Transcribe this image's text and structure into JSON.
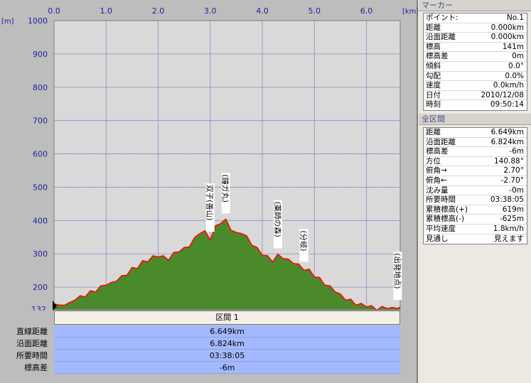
{
  "chart": {
    "unit_left": "[m]",
    "unit_right": "[km]",
    "x_ticks": [
      "0.0",
      "1.0",
      "2.0",
      "3.0",
      "4.0",
      "5.0",
      "6.0"
    ],
    "y_ticks": [
      "1000",
      "900",
      "800",
      "700",
      "600",
      "500",
      "400",
      "300",
      "200"
    ],
    "y_min_label": "132",
    "annotations": [
      {
        "text": "双子(善山)",
        "km": 3.0
      },
      {
        "text": "(鐘ガ丸)",
        "km": 3.3
      },
      {
        "text": "(薬師の森)",
        "km": 4.3
      },
      {
        "text": "(分岐)",
        "km": 4.8
      },
      {
        "text": "(出発地点)",
        "km": 6.6
      }
    ],
    "colors": {
      "fill": "#4a8a2a",
      "line": "#ff0000",
      "plot_bg": "#d9d9d9",
      "grid": "#4040c0"
    }
  },
  "chart_data": {
    "type": "area",
    "xlabel": "[km]",
    "ylabel": "[m]",
    "xlim": [
      0,
      6.649
    ],
    "ylim": [
      132,
      1000
    ],
    "grid": true,
    "x": [
      0.0,
      0.1,
      0.2,
      0.3,
      0.4,
      0.5,
      0.6,
      0.7,
      0.8,
      0.9,
      1.0,
      1.1,
      1.2,
      1.3,
      1.4,
      1.5,
      1.6,
      1.7,
      1.8,
      1.9,
      2.0,
      2.1,
      2.2,
      2.3,
      2.4,
      2.5,
      2.6,
      2.7,
      2.8,
      2.9,
      3.0,
      3.1,
      3.2,
      3.3,
      3.4,
      3.5,
      3.6,
      3.7,
      3.8,
      3.9,
      4.0,
      4.1,
      4.2,
      4.3,
      4.4,
      4.5,
      4.6,
      4.7,
      4.8,
      4.9,
      5.0,
      5.1,
      5.2,
      5.3,
      5.4,
      5.5,
      5.6,
      5.7,
      5.8,
      5.9,
      6.0,
      6.1,
      6.2,
      6.3,
      6.4,
      6.5,
      6.6,
      6.649
    ],
    "y": [
      150,
      142,
      150,
      150,
      165,
      170,
      175,
      185,
      190,
      200,
      210,
      210,
      222,
      230,
      240,
      255,
      260,
      275,
      280,
      290,
      295,
      290,
      285,
      300,
      310,
      315,
      325,
      345,
      365,
      365,
      345,
      380,
      395,
      400,
      375,
      360,
      365,
      350,
      330,
      315,
      300,
      290,
      280,
      295,
      290,
      280,
      275,
      265,
      255,
      250,
      235,
      225,
      210,
      200,
      190,
      175,
      165,
      160,
      150,
      147,
      145,
      140,
      135,
      138,
      140,
      135,
      140,
      141
    ]
  },
  "section": {
    "header": "区間 1",
    "rows": [
      {
        "label": "直線距離",
        "value": "6.649km"
      },
      {
        "label": "沿面距離",
        "value": "6.824km"
      },
      {
        "label": "所要時間",
        "value": "03:38:05"
      },
      {
        "label": "標高差",
        "value": "-6m"
      }
    ]
  },
  "marker_panel": {
    "title": "マーカー",
    "rows": [
      {
        "label": "ポイント:",
        "value": "No.1"
      },
      {
        "label": "距離",
        "value": "0.000km"
      },
      {
        "label": "沿面距離",
        "value": "0.000km"
      },
      {
        "label": "標高",
        "value": "141m"
      },
      {
        "label": "標高差",
        "value": "0m"
      },
      {
        "label": "傾斜",
        "value": "0.0°"
      },
      {
        "label": "勾配",
        "value": "0.0%"
      },
      {
        "label": "速度",
        "value": "0.0km/h"
      },
      {
        "label": "日付",
        "value": "2010/12/08"
      },
      {
        "label": "時刻",
        "value": "09:50:14"
      }
    ]
  },
  "total_panel": {
    "title": "全区間",
    "rows": [
      {
        "label": "距離",
        "value": "6.649km"
      },
      {
        "label": "沿面距離",
        "value": "6.824km"
      },
      {
        "label": "標高差",
        "value": "-6m"
      },
      {
        "label": "方位",
        "value": "140.88°"
      },
      {
        "label": "俯角→",
        "value": "2.70°"
      },
      {
        "label": "俯角←",
        "value": "-2.70°"
      },
      {
        "label": "沈み量",
        "value": "-0m"
      },
      {
        "label": "所要時間",
        "value": "03:38:05"
      },
      {
        "label": "累積標高(+)",
        "value": "619m"
      },
      {
        "label": "累積標高(-)",
        "value": "-625m"
      },
      {
        "label": "平均速度",
        "value": "1.8km/h"
      },
      {
        "label": "見通し",
        "value": "見えます"
      }
    ]
  }
}
